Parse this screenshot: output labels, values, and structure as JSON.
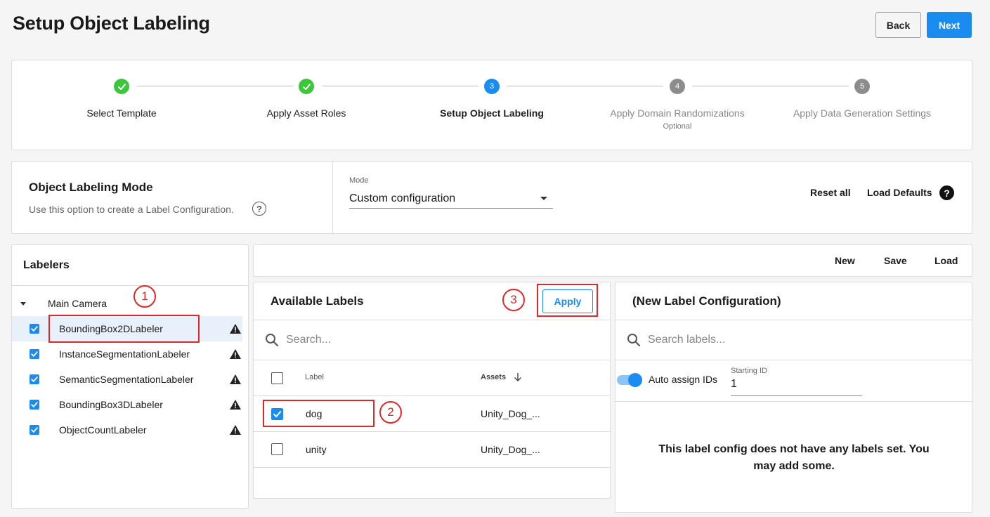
{
  "header": {
    "title": "Setup Object Labeling",
    "back_label": "Back",
    "next_label": "Next"
  },
  "stepper": {
    "steps": [
      {
        "label": "Select Template",
        "status": "complete",
        "number": "1"
      },
      {
        "label": "Apply Asset Roles",
        "status": "complete",
        "number": "2"
      },
      {
        "label": "Setup Object Labeling",
        "status": "active",
        "number": "3"
      },
      {
        "label": "Apply Domain Randomizations",
        "status": "pending",
        "number": "4",
        "sub": "Optional"
      },
      {
        "label": "Apply Data Generation Settings",
        "status": "pending",
        "number": "5"
      }
    ]
  },
  "mode_panel": {
    "title": "Object Labeling Mode",
    "description": "Use this option to create a Label Configuration.",
    "mode_label": "Mode",
    "mode_value": "Custom configuration",
    "reset_all": "Reset all",
    "load_defaults": "Load Defaults"
  },
  "labelers": {
    "title": "Labelers",
    "camera": "Main Camera",
    "items": [
      {
        "name": "BoundingBox2DLabeler",
        "checked": true,
        "selected": true
      },
      {
        "name": "InstanceSegmentationLabeler",
        "checked": true
      },
      {
        "name": "SemanticSegmentationLabeler",
        "checked": true
      },
      {
        "name": "BoundingBox3DLabeler",
        "checked": true
      },
      {
        "name": "ObjectCountLabeler",
        "checked": true
      }
    ]
  },
  "toolbar": {
    "new_label": "New",
    "save_label": "Save",
    "load_label": "Load"
  },
  "available_labels": {
    "title": "Available Labels",
    "apply_label": "Apply",
    "search_placeholder": "Search...",
    "columns": {
      "label": "Label",
      "assets": "Assets"
    },
    "rows": [
      {
        "label": "dog",
        "assets": "Unity_Dog_...",
        "checked": true
      },
      {
        "label": "unity",
        "assets": "Unity_Dog_...",
        "checked": false
      }
    ]
  },
  "label_config": {
    "title": "(New Label Configuration)",
    "search_placeholder": "Search labels...",
    "auto_assign_label": "Auto assign IDs",
    "starting_id_label": "Starting ID",
    "starting_id_value": "1",
    "empty_message": "This label config does not have any labels set. You may add some."
  },
  "annotations": [
    "1",
    "2",
    "3"
  ],
  "colors": {
    "accent": "#1a8cf0",
    "complete": "#3cc63c",
    "pending": "#8c8c8c",
    "annotation": "#e02828"
  }
}
